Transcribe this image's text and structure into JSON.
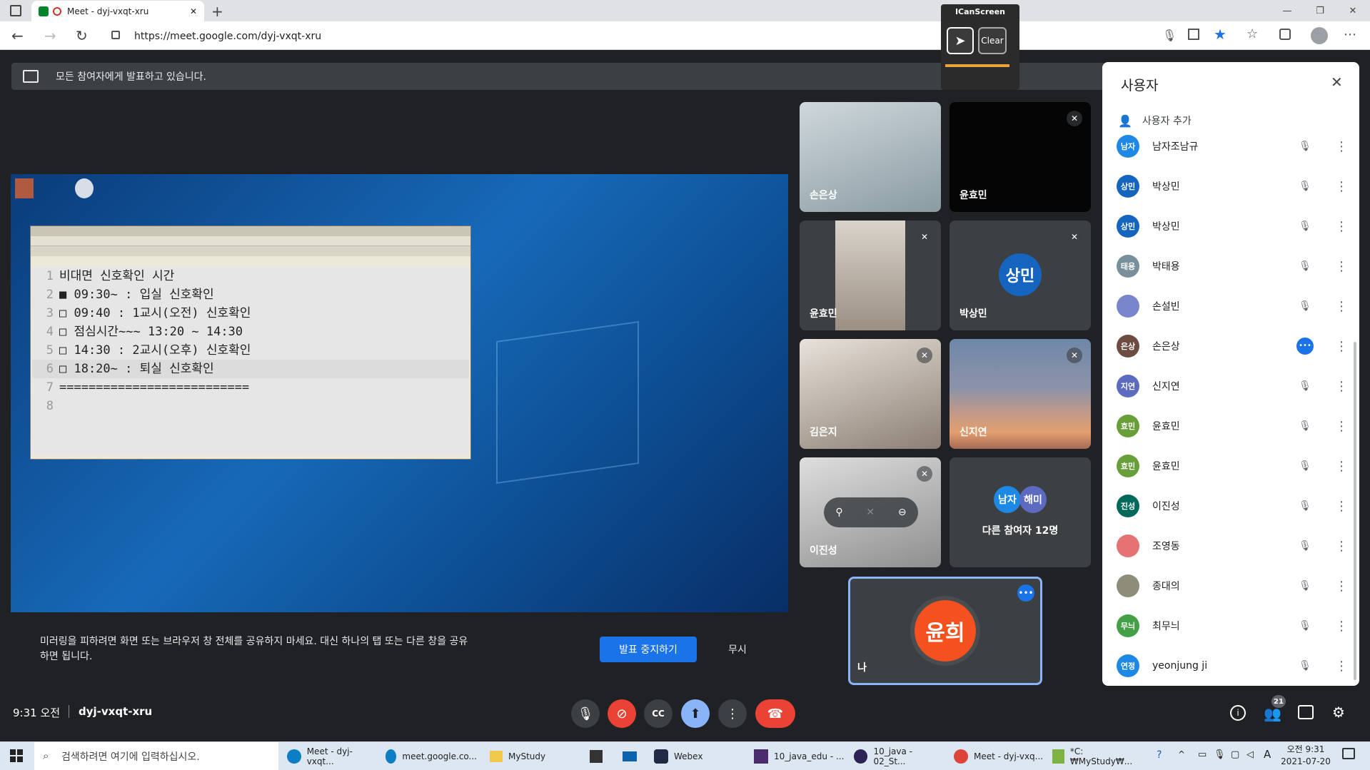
{
  "browser": {
    "tab_title": "Meet - dyj-vxqt-xru",
    "url": "https://meet.google.com/dyj-vxqt-xru",
    "new_tab": "+",
    "win_min": "—",
    "win_max": "❐",
    "win_close": "✕"
  },
  "icanscreen": {
    "title": "ICanScreen",
    "clear_label": "Clear"
  },
  "banner": {
    "text": "모든 참여자에게 발표하고 있습니다."
  },
  "editor": {
    "lines": [
      {
        "n": "1",
        "text": "비대면 신호확인 시간"
      },
      {
        "n": "2",
        "text": "■ 09:30~ : 입실 신호확인"
      },
      {
        "n": "3",
        "text": "□ 09:40 : 1교시(오전) 신호확인"
      },
      {
        "n": "4",
        "text": "□ 점심시간~~~ 13:20 ~ 14:30"
      },
      {
        "n": "5",
        "text": "□ 14:30 : 2교시(오후) 신호확인"
      },
      {
        "n": "6",
        "text": "□ 18:20~ : 퇴실 신호확인"
      },
      {
        "n": "7",
        "text": "=========================="
      },
      {
        "n": "8",
        "text": ""
      }
    ]
  },
  "tiles": {
    "t1": "손은상",
    "t2": "윤효민",
    "t3": "윤효민",
    "t4": "박상민",
    "t4_avatar": "상민",
    "t5": "김은지",
    "t6": "신지연",
    "t7": "이진성",
    "others_label": "다른 참여자 12명",
    "others_av1": "남자",
    "others_av2": "해미",
    "self_label": "나",
    "self_avatar": "윤희"
  },
  "notice": {
    "text": "미러링을 피하려면 화면 또는 브라우저 창 전체를 공유하지 마세요. 대신 하나의 탭 또는 다른 창을 공유하면 됩니다.",
    "stop_label": "발표 중지하기",
    "dismiss_label": "무시"
  },
  "footer": {
    "time": "9:31 오전",
    "code": "dyj-vxqt-xru",
    "people_count": "21"
  },
  "panel": {
    "title": "사용자",
    "add_label": "사용자 추가",
    "people": [
      {
        "initials": "남자",
        "name": "남자조남규",
        "color": "#1e88e5"
      },
      {
        "initials": "상민",
        "name": "박상민",
        "color": "#1565c0"
      },
      {
        "initials": "상민",
        "name": "박상민",
        "color": "#1565c0"
      },
      {
        "initials": "태용",
        "name": "박태용",
        "color": "#78909c"
      },
      {
        "initials": "",
        "name": "손설빈",
        "color": "#7986cb"
      },
      {
        "initials": "은상",
        "name": "손은상",
        "color": "#6d4c41"
      },
      {
        "initials": "지연",
        "name": "신지연",
        "color": "#5c6bc0"
      },
      {
        "initials": "효민",
        "name": "윤효민",
        "color": "#689f38"
      },
      {
        "initials": "효민",
        "name": "윤효민",
        "color": "#689f38"
      },
      {
        "initials": "진성",
        "name": "이진성",
        "color": "#00695c"
      },
      {
        "initials": "",
        "name": "조영동",
        "color": "#e57373"
      },
      {
        "initials": "",
        "name": "종대의",
        "color": "#8d8d7a"
      },
      {
        "initials": "무늬",
        "name": "최무늬",
        "color": "#43a047"
      },
      {
        "initials": "연정",
        "name": "yeonjung ji",
        "color": "#1e88e5"
      }
    ]
  },
  "taskbar": {
    "search_placeholder": "검색하려면 여기에 입력하십시오.",
    "items": [
      "Meet - dyj-vxqt...",
      "meet.google.co...",
      "MyStudy",
      "Webex",
      "10_java_edu - ...",
      "10_java - 02_St...",
      "Meet - dyj-vxq...",
      "*C:₩MyStudy₩..."
    ],
    "clock_time": "오전 9:31",
    "clock_date": "2021-07-20",
    "ime": "A"
  }
}
